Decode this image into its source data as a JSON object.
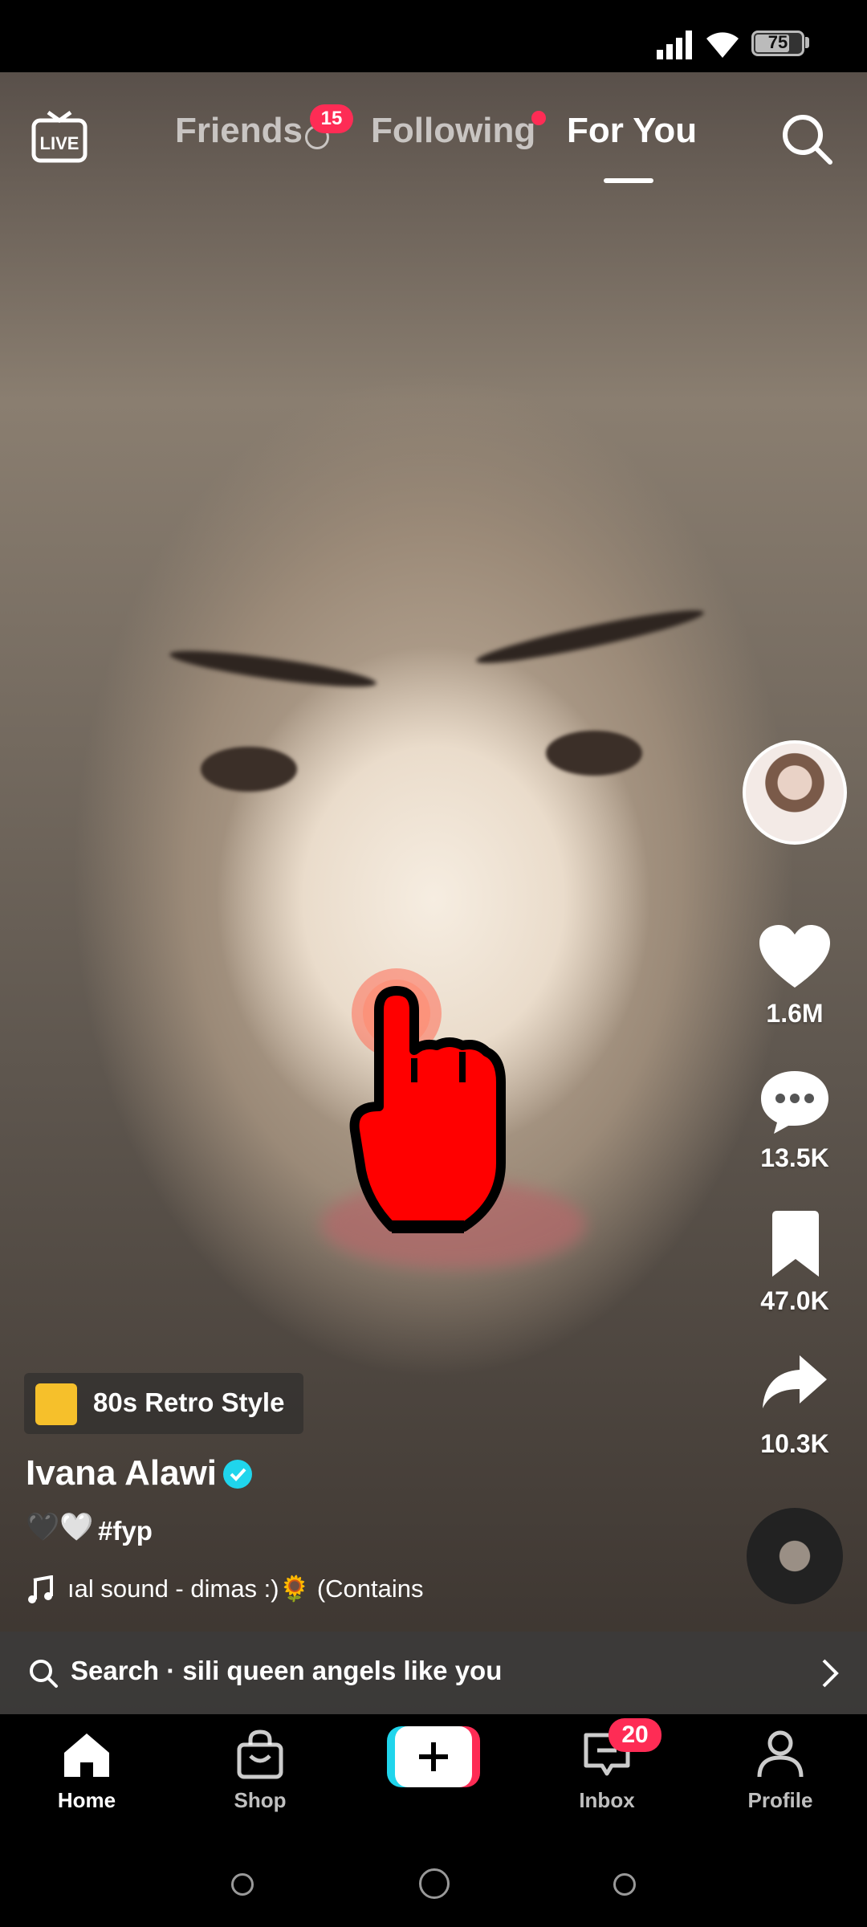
{
  "status_bar": {
    "battery": "75"
  },
  "top_nav": {
    "live_label": "LIVE",
    "tabs": [
      {
        "label": "Friends",
        "badge": "15"
      },
      {
        "label": "Following"
      },
      {
        "label": "For You"
      }
    ]
  },
  "video": {
    "effect_label": "80s Retro Style",
    "username": "Ivana Alawi",
    "caption_emoji": "🖤🤍",
    "caption_tag": "#fyp",
    "sound": "ıal sound - dimas :)🌻 (Contains"
  },
  "right_rail": {
    "likes": "1.6M",
    "comments": "13.5K",
    "saves": "47.0K",
    "shares": "10.3K"
  },
  "search_bar": {
    "label": "Search · sili queen angels like you"
  },
  "bottom_nav": {
    "home": "Home",
    "shop": "Shop",
    "inbox": "Inbox",
    "inbox_badge": "20",
    "profile": "Profile"
  }
}
